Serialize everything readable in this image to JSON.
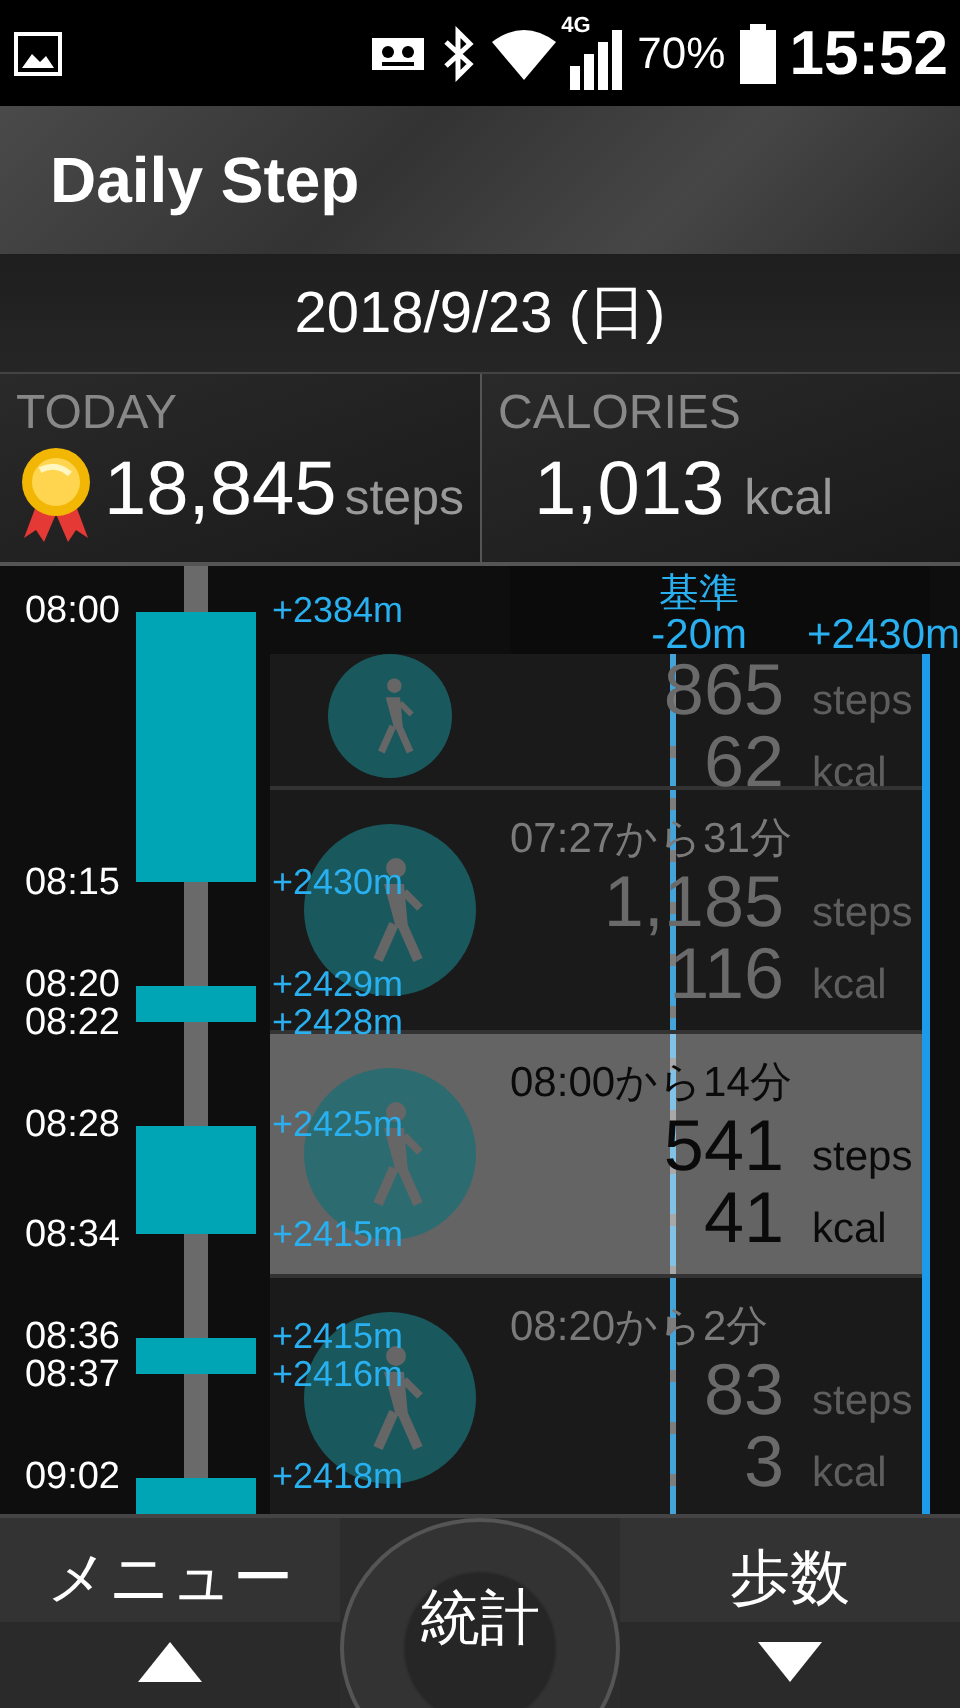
{
  "status_bar": {
    "network": "4G",
    "battery": "70%",
    "time": "15:52"
  },
  "app_bar": {
    "title": "Daily Step"
  },
  "date": "2018/9/23 (日)",
  "summary": {
    "today_label": "TODAY",
    "steps": "18,845",
    "steps_unit": "steps",
    "calories_label": "CALORIES",
    "calories": "1,013",
    "calories_unit": "kcal"
  },
  "altitude_header": {
    "baseline_label": "基準",
    "baseline_value": "-20m",
    "max_value": "+2430m"
  },
  "segments": [
    {
      "start": "08:00",
      "end": "08:15",
      "start_alt": "+2384m",
      "end_alt": "+2430m"
    },
    {
      "start": "08:20",
      "end": "08:22",
      "start_alt": "+2429m",
      "end_alt": "+2428m"
    },
    {
      "start": "08:28",
      "end": "08:34",
      "start_alt": "+2425m",
      "end_alt": "+2415m"
    },
    {
      "start": "08:36",
      "end": "08:37",
      "start_alt": "+2415m",
      "end_alt": "+2416m"
    },
    {
      "start": "09:02",
      "start_alt": "+2418m"
    }
  ],
  "activities": [
    {
      "steps": "865",
      "steps_unit": "steps",
      "kcal": "62",
      "kcal_unit": "kcal",
      "selected": false
    },
    {
      "title": "07:27から31分",
      "steps": "1,185",
      "steps_unit": "steps",
      "kcal": "116",
      "kcal_unit": "kcal",
      "selected": false
    },
    {
      "title": "08:00から14分",
      "steps": "541",
      "steps_unit": "steps",
      "kcal": "41",
      "kcal_unit": "kcal",
      "selected": true
    },
    {
      "title": "08:20から2分",
      "steps": "83",
      "steps_unit": "steps",
      "kcal": "3",
      "kcal_unit": "kcal",
      "selected": false
    }
  ],
  "nav": {
    "left": "メニュー",
    "center": "統計",
    "right": "歩数"
  }
}
